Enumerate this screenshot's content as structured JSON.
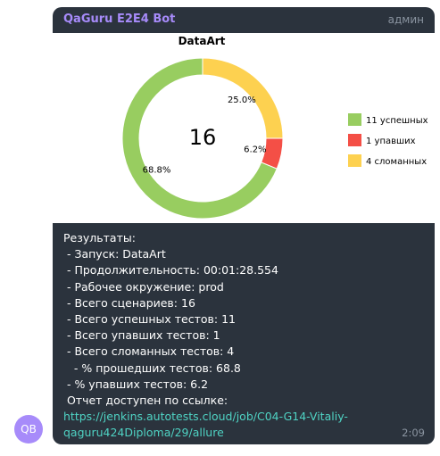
{
  "header": {
    "bot_name": "QaGuru E2E4 Bot",
    "role": "админ"
  },
  "avatar": {
    "initials": "QB",
    "color": "#a78bfa"
  },
  "chart_data": {
    "type": "pie",
    "title": "DataArt",
    "center_label": "16",
    "slices": [
      {
        "label": "11 успешных",
        "value": 68.8,
        "pct_label": "68.8%",
        "color": "#98cd60"
      },
      {
        "label": "1 упавших",
        "value": 6.2,
        "pct_label": "6.2%",
        "color": "#f44f46"
      },
      {
        "label": "4 сломанных",
        "value": 25.0,
        "pct_label": "25.0%",
        "color": "#fdd150"
      }
    ],
    "legend_position": "right"
  },
  "message": {
    "lines": [
      "Результаты:",
      " - Запуск: DataArt",
      " - Продолжительность: 00:01:28.554",
      " - Рабочее окружение: prod",
      " - Всего сценариев: 16",
      " - Всего успешных тестов: 11",
      " - Всего упавших тестов: 1",
      " - Всего сломанных тестов: 4",
      "   - % прошедших тестов: 68.8",
      " - % упавших тестов: 6.2",
      " Отчет доступен по ссылке:"
    ],
    "link_text": "https://jenkins.autotests.cloud/job/C04-G14-Vitaliy-qaguru424Diploma/29/allure",
    "link_line_1": "https://jenkins.autotests.cloud/job/C04-G14-Vitaliy-",
    "link_line_2": "qaguru424Diploma/29/allure",
    "time": "2:09"
  }
}
